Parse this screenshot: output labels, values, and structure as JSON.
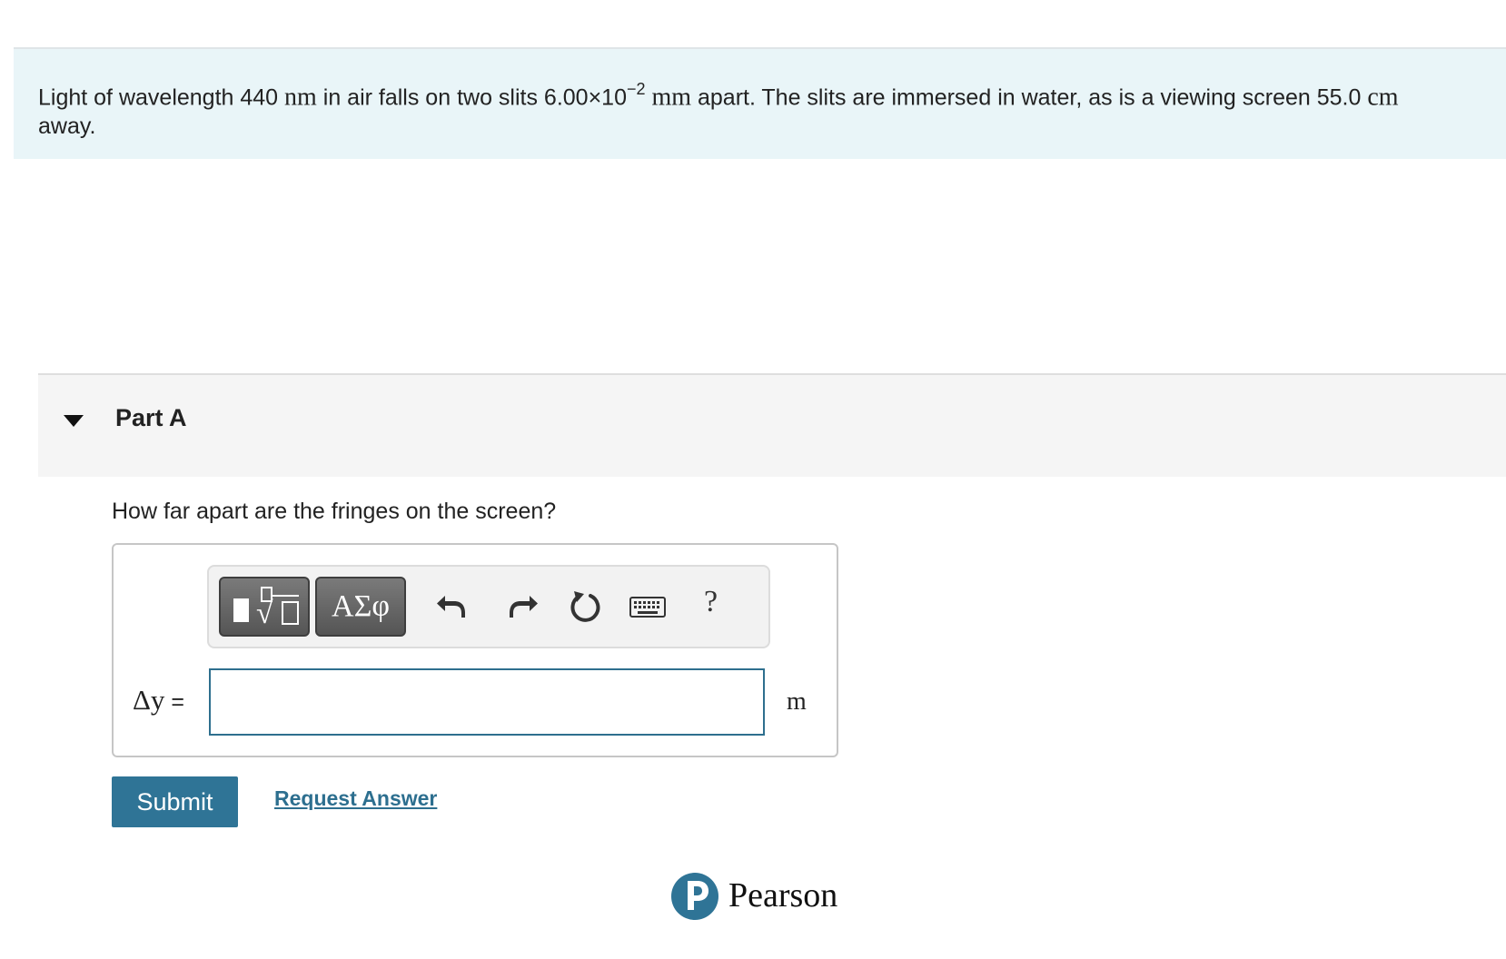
{
  "problem": {
    "t1": "Light of wavelength 440 ",
    "u1": "nm",
    "t2": " in air falls on two slits 6.00×10",
    "exp": "−2",
    "u2": "mm",
    "t3": " apart. The slits are immersed in water, as is a viewing screen 55.0 ",
    "u3": "cm",
    "t4": " away."
  },
  "part": {
    "title": "Part A",
    "question": "How far apart are the fringes on the screen?"
  },
  "toolbar": {
    "templates_icon": "templates-icon",
    "symbols_label": "ΑΣφ",
    "undo_icon": "undo-icon",
    "redo_icon": "redo-icon",
    "reset_icon": "reset-icon",
    "keyboard_icon": "keyboard-icon",
    "help_label": "?"
  },
  "answer": {
    "variable_symbol": "Δy",
    "equals": " =",
    "value": "",
    "unit": "m"
  },
  "actions": {
    "submit_label": "Submit",
    "request_label": "Request Answer"
  },
  "footer": {
    "brand": "Pearson",
    "brand_color": "#2f7496"
  }
}
